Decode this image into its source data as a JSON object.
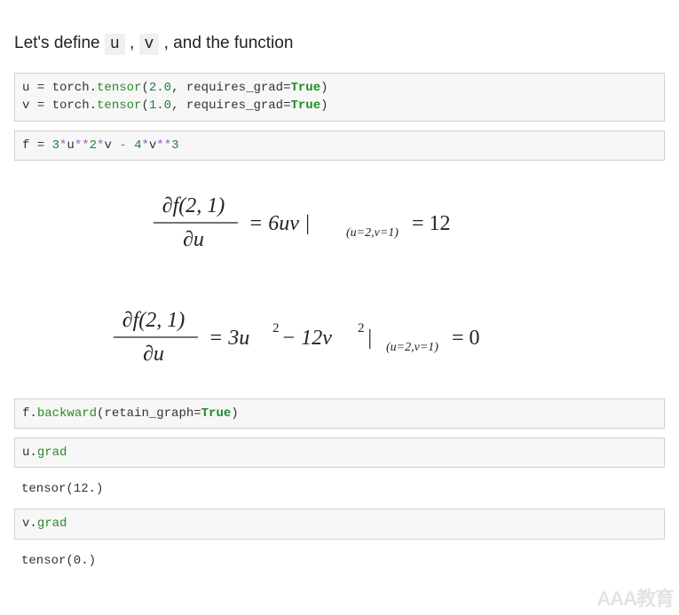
{
  "intro": {
    "prefix": "Let's define ",
    "code_u": "u",
    "sep1": ", ",
    "code_v": "v",
    "suffix": ", and the function"
  },
  "code": {
    "cell1_line1": {
      "a": "u = torch.",
      "tensor": "tensor",
      "b": "(",
      "num1": "2.0",
      "c": ", requires_grad=",
      "kw": "True",
      "d": ")"
    },
    "cell1_line2": {
      "a": "v = torch.",
      "tensor": "tensor",
      "b": "(",
      "num1": "1.0",
      "c": ", requires_grad=",
      "kw": "True",
      "d": ")"
    },
    "cell2": {
      "a": "f = ",
      "n3": "3",
      "op1": "*",
      "u": "u",
      "op2": "**",
      "n2a": "2",
      "op3": "*",
      "v": "v",
      "sp": " ",
      "op4": "-",
      "sp2": " ",
      "n4": "4",
      "op5": "*",
      "v2": "v",
      "op6": "**",
      "n2b": "3"
    },
    "cell3": {
      "a": "f.",
      "fn": "backward",
      "b": "(retain_graph=",
      "kw": "True",
      "c": ")"
    },
    "cell4": {
      "a": "u.",
      "g": "grad"
    },
    "out4": "tensor(12.)",
    "cell5": {
      "a": "v.",
      "g": "grad"
    },
    "out5": "tensor(0.)"
  },
  "math": {
    "eq1": {
      "num": "∂f(2, 1)",
      "den": "∂u",
      "rhs_a": " = 6uv |",
      "sub": "(u=2,v=1)",
      "rhs_b": "= 12"
    },
    "eq2": {
      "num": "∂f(2, 1)",
      "den": "∂u",
      "rhs_a": " = 3u",
      "sup1": "2",
      "rhs_b": " − 12v",
      "sup2": "2",
      "rhs_c": " |",
      "sub": "(u=2,v=1)",
      "rhs_d": "= 0"
    }
  },
  "watermark": "AAA教育"
}
